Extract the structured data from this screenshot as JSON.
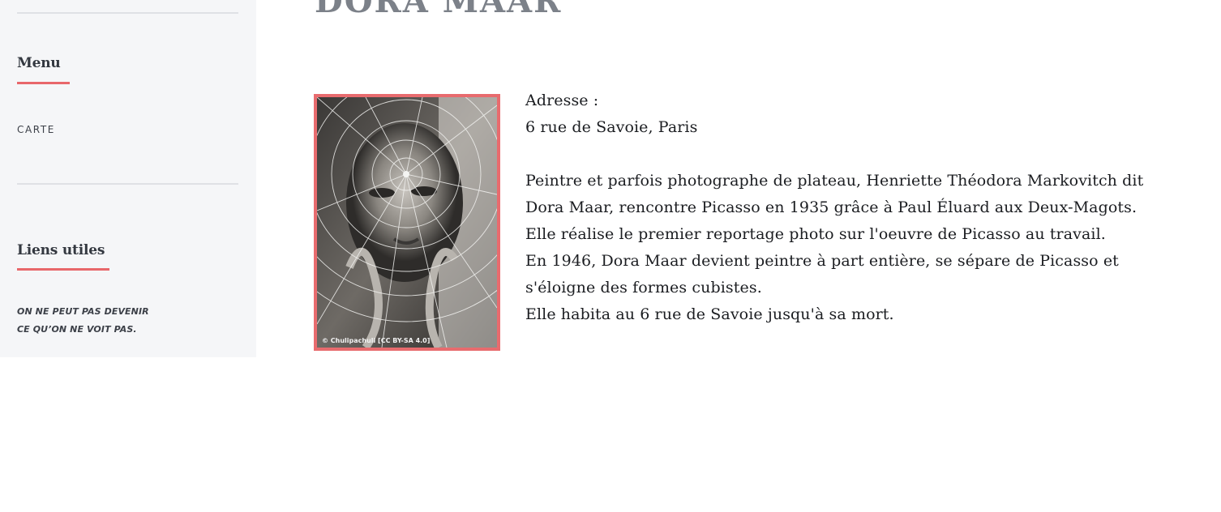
{
  "sidebar": {
    "menu_title": "Menu",
    "menu_items": [
      {
        "label": "CARTE"
      }
    ],
    "links_title": "Liens utiles",
    "quote_lines": [
      "ON NE PEUT PAS DEVENIR",
      "CE QU’ON NE VOIT PAS."
    ]
  },
  "article": {
    "title": "DORA MAAR",
    "photo_credit": "© Chulipachuli [CC BY-SA 4.0]",
    "address_label": "Adresse :",
    "address": "6 rue de Savoie, Paris",
    "paragraphs": [
      "Peintre et parfois photographe de plateau, Henriette Théodora Markovitch dit",
      "Dora Maar, rencontre Picasso en 1935 grâce à Paul Éluard aux Deux-Magots.",
      "Elle réalise le premier reportage photo sur l'oeuvre de Picasso au travail.",
      "En 1946, Dora Maar devient peintre à part entière, se sépare de Picasso et",
      "s'éloigne des formes cubistes.",
      "Elle habita au 6 rue de Savoie jusqu'à sa mort."
    ]
  },
  "colors": {
    "accent": "#e8676b",
    "sidebar_bg": "#f5f6f8",
    "title_gray": "#7c8189"
  }
}
